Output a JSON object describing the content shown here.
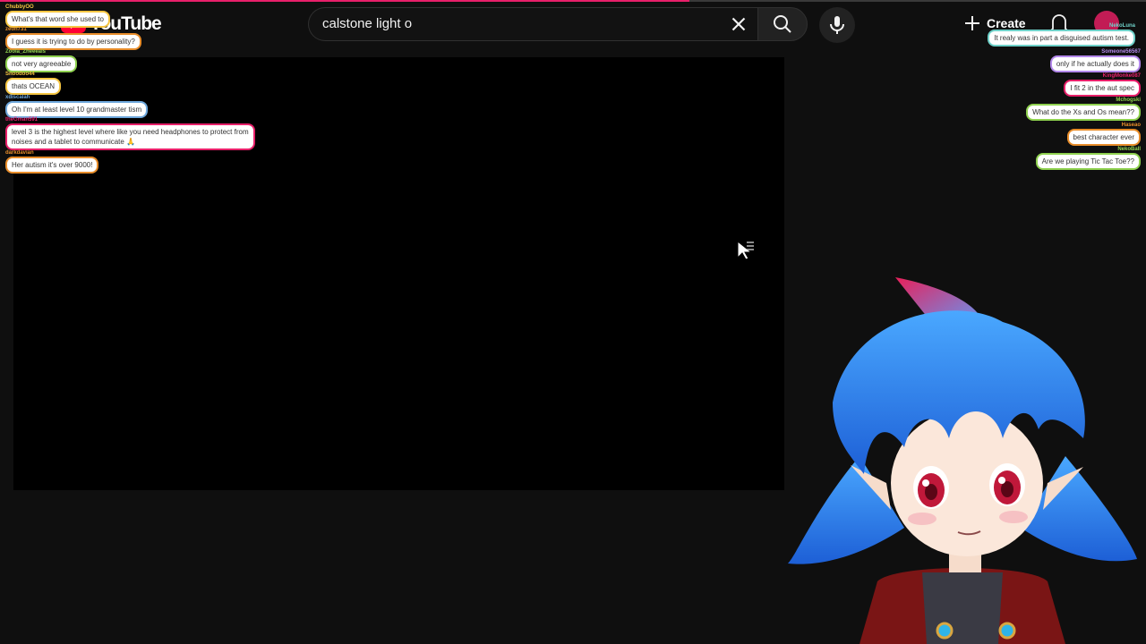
{
  "header": {
    "logo_text": "YouTube",
    "search_value": "calstone light o",
    "create_label": "Create"
  },
  "chat_left": [
    {
      "name": "ChubbyOO",
      "text": "What's that word she used to",
      "color": "#f5c542"
    },
    {
      "name": "zeon731",
      "text": "I guess it is trying to do by personality?",
      "color": "#e88d2a"
    },
    {
      "name": "Zoola_Zheeeals",
      "text": "not very agreeable",
      "color": "#8fd14f"
    },
    {
      "name": "Snoodoo44",
      "text": "thats OCEAN",
      "color": "#f5c542"
    },
    {
      "name": "xdiscalah",
      "text": "Oh I'm at least level 10 grandmaster tism",
      "color": "#6fa8dc"
    },
    {
      "name": "theGman591",
      "text": "level 3 is the highest level where like you need headphones to protect from noises and a tablet to communicate 🙏",
      "color": "#e8206a"
    },
    {
      "name": "darkdavian",
      "text": "Her autism it's over 9000!",
      "color": "#e88d2a"
    }
  ],
  "chat_right": [
    {
      "name": "NekoLuna",
      "text": "It realy was in part a disguised autism test.",
      "color": "#6fd1c9"
    },
    {
      "name": "Someone56567",
      "text": "only if he actually does it",
      "color": "#b388eb"
    },
    {
      "name": "KingMonke087",
      "text": "I fit 2 in the aut spec",
      "color": "#e8206a"
    },
    {
      "name": "Mchogski",
      "text": "What do the Xs and Os mean??",
      "color": "#8fd14f"
    },
    {
      "name": "Haseao",
      "text": "best character ever",
      "color": "#e88d2a"
    },
    {
      "name": "NekoBall",
      "text": "Are we playing Tic Tac Toe??",
      "color": "#8fd14f"
    }
  ]
}
